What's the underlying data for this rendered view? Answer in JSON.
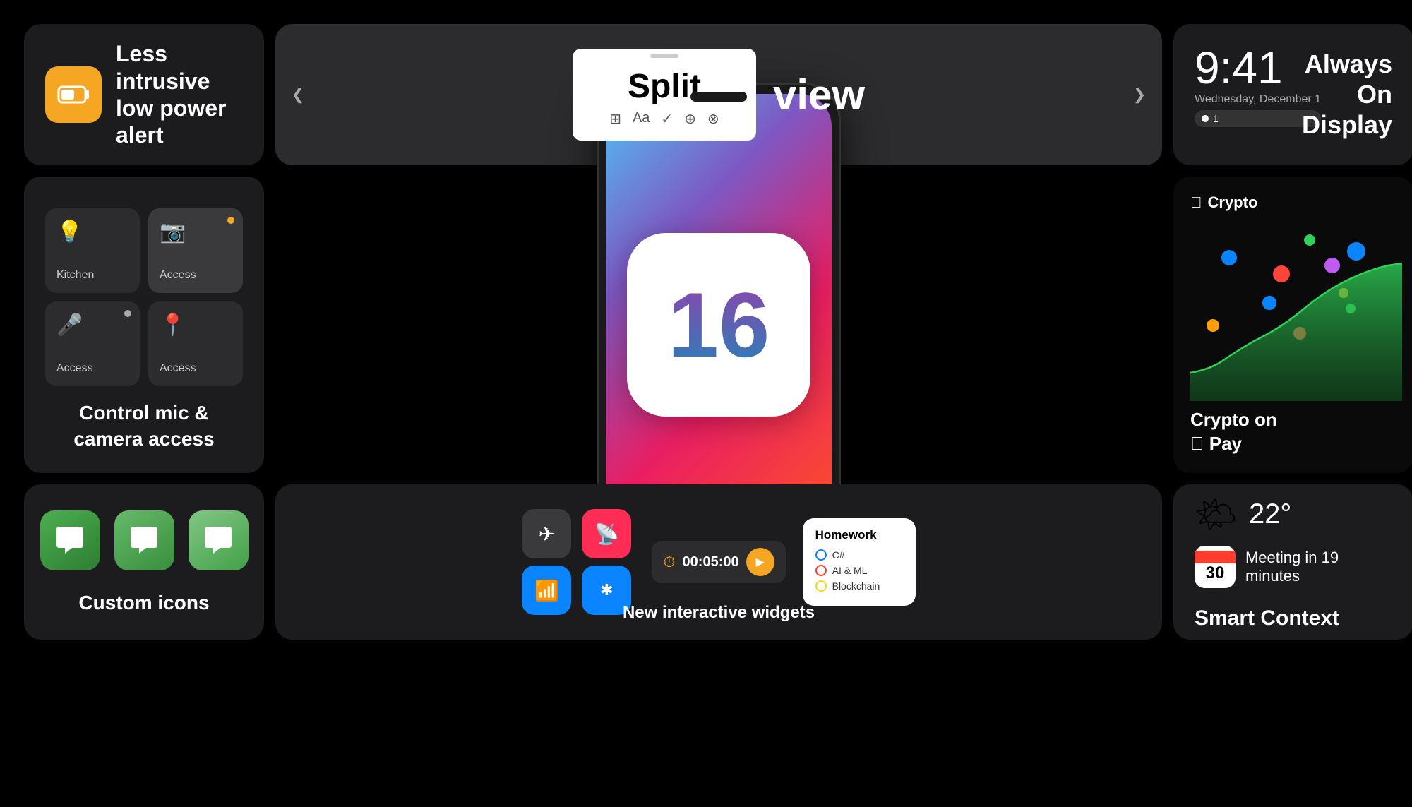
{
  "cards": {
    "low_power": {
      "title": "Less intrusive low power alert",
      "icon_label": "battery-icon"
    },
    "split_view": {
      "word1": "Split",
      "word2": "view",
      "arrow_left": "❮",
      "arrow_right": "❯"
    },
    "always_on": {
      "time": "9:41",
      "day": "Wednesday, December 1",
      "indicator_num": "1",
      "label_line1": "Always",
      "label_line2": "On",
      "label_line3": "Display"
    },
    "mic_camera": {
      "cell1_label": "Kitchen",
      "cell2_label": "Access",
      "cell3_label": "Access",
      "cell4_label": "Access",
      "description": "Control mic & camera access"
    },
    "ios16": {
      "number": "16"
    },
    "crypto": {
      "brand": "Crypto",
      "footer_line1": "Crypto on",
      "footer_line2": "Pay"
    },
    "custom_icons": {
      "label": "Custom icons"
    },
    "interactive_widgets": {
      "timer_time": "00:05:00",
      "homework_title": "Homework",
      "homework_item1": "C#",
      "homework_item2": "AI & ML",
      "homework_item3": "Blockchain",
      "label": "New interactive widgets"
    },
    "smart_context": {
      "temperature": "22°",
      "cal_month": "",
      "cal_day": "30",
      "meeting_text": "Meeting in 19 minutes",
      "label": "Smart Context"
    }
  }
}
